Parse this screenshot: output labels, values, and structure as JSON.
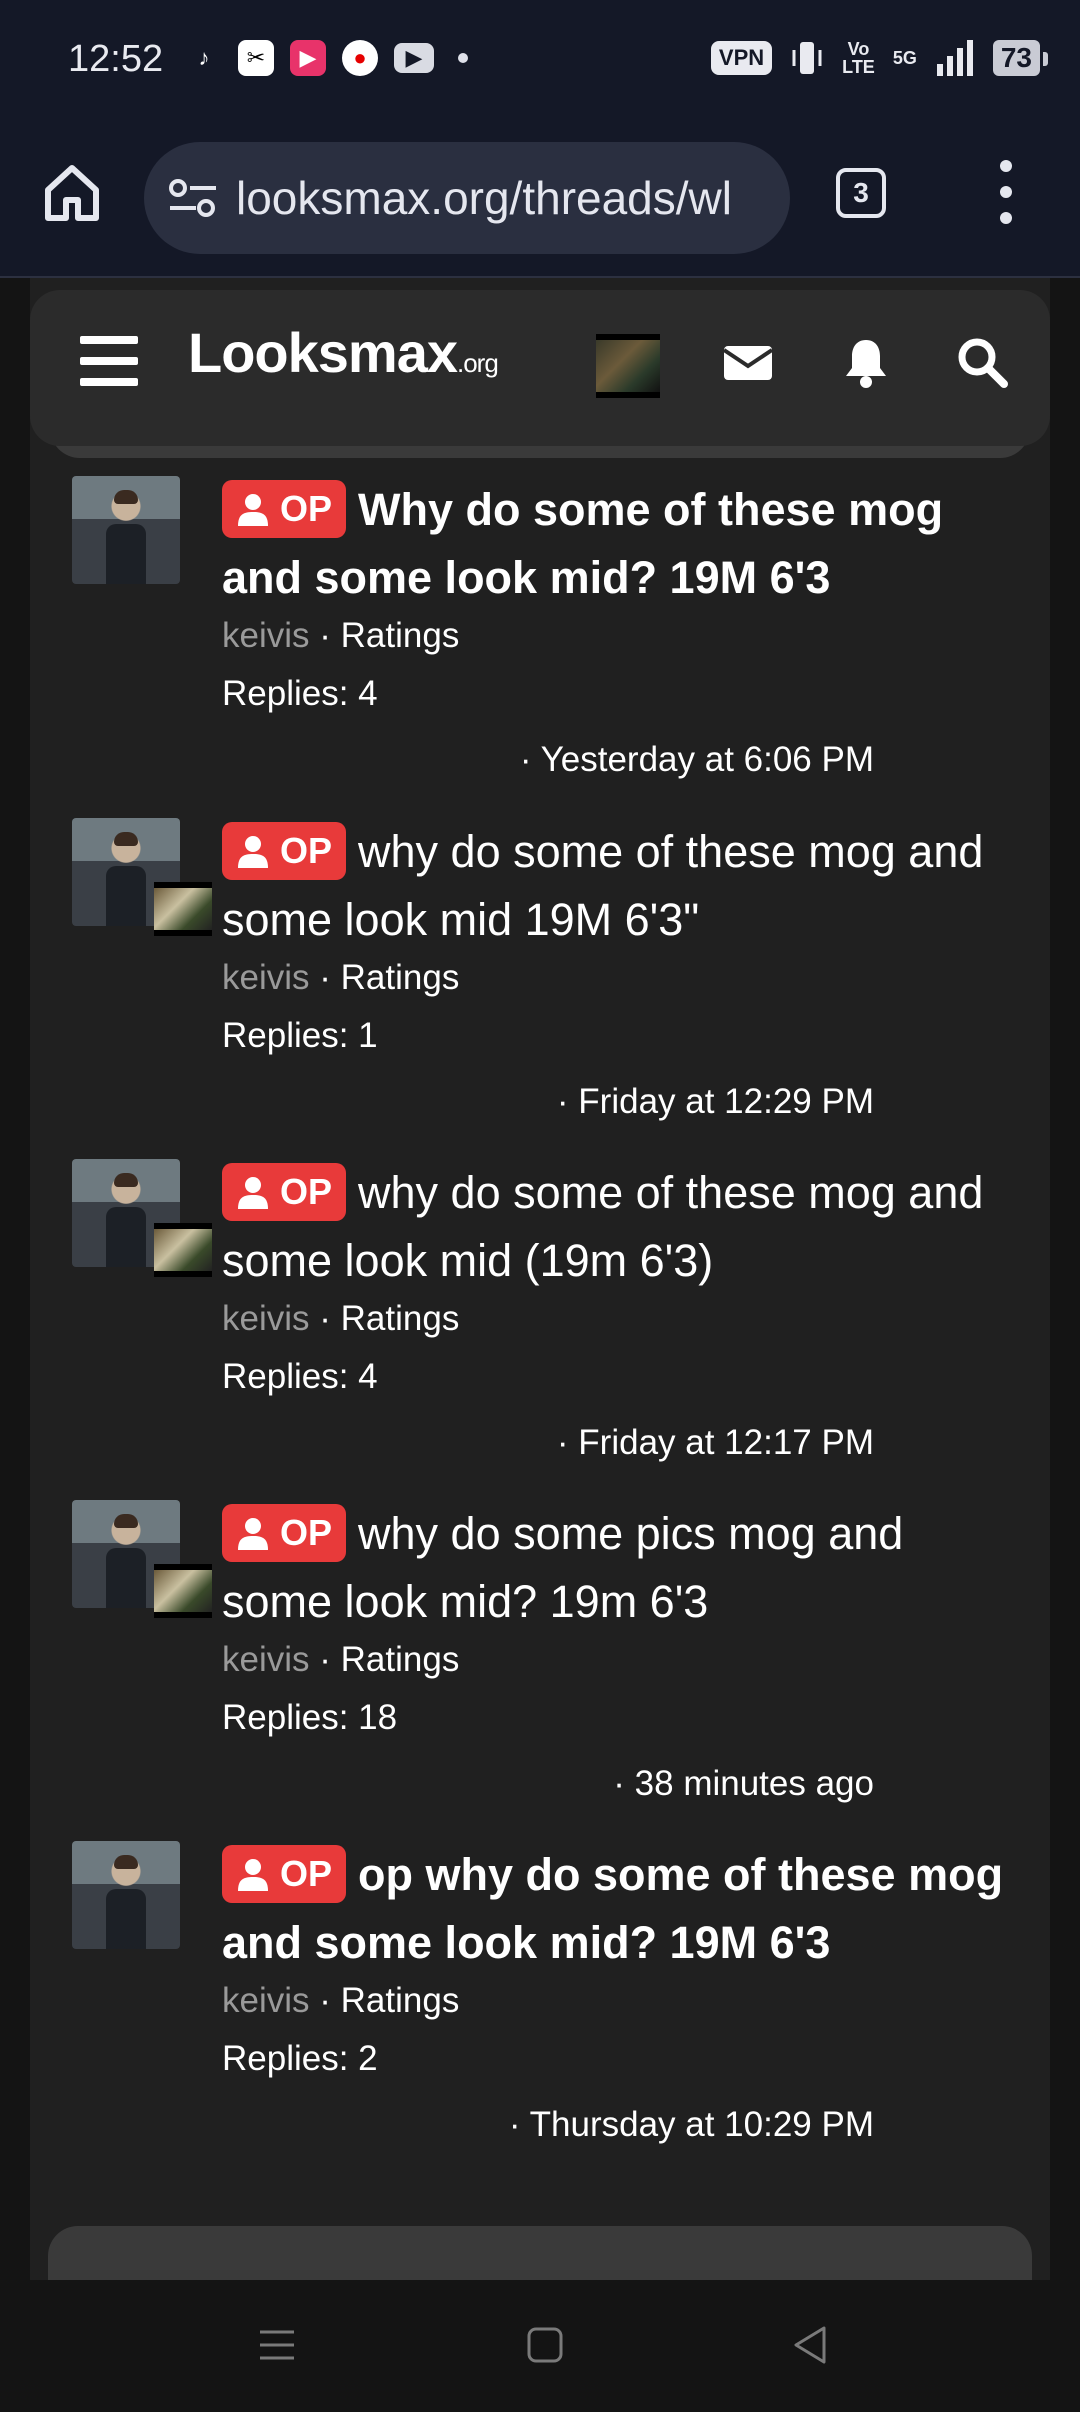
{
  "status_bar": {
    "time": "12:52",
    "apps": [
      "tiktok-icon",
      "capcut-icon",
      "video-app-icon",
      "vodafone-icon",
      "youtube-icon"
    ],
    "vpn": "VPN",
    "volte_line1": "Vo",
    "volte_line2": "LTE",
    "network": "5G",
    "battery": "73"
  },
  "browser": {
    "url": "looksmax.org/threads/wl",
    "tab_count": "3"
  },
  "site": {
    "logo_main": "Looksmax",
    "logo_suffix": ".org"
  },
  "threads": [
    {
      "badge": "OP",
      "title": "Why do some of these mog and some look mid? 19M 6'3",
      "unread": true,
      "author": "keivis",
      "forum": "Ratings",
      "replies": "Replies: 4",
      "date": "· Yesterday at 6:06 PM",
      "has_mini_avatar": false
    },
    {
      "badge": "OP",
      "title": "why do some of these mog and some look mid 19M 6'3\"",
      "unread": false,
      "author": "keivis",
      "forum": "Ratings",
      "replies": "Replies: 1",
      "date": "· Friday at 12:29 PM",
      "has_mini_avatar": true
    },
    {
      "badge": "OP",
      "title": "why do some of these mog and some look mid (19m 6'3)",
      "unread": false,
      "author": "keivis",
      "forum": "Ratings",
      "replies": "Replies: 4",
      "date": "· Friday at 12:17 PM",
      "has_mini_avatar": true
    },
    {
      "badge": "OP",
      "title": "why do some pics mog and some look mid? 19m 6'3",
      "unread": false,
      "author": "keivis",
      "forum": "Ratings",
      "replies": "Replies: 18",
      "date": "· 38 minutes ago",
      "has_mini_avatar": true
    },
    {
      "badge": "OP",
      "title": "op why do some of these mog and some look mid? 19M 6'3",
      "unread": true,
      "author": "keivis",
      "forum": "Ratings",
      "replies": "Replies: 2",
      "date": "· Thursday at 10:29 PM",
      "has_mini_avatar": false
    }
  ],
  "colors": {
    "op_badge": "#e83a3a",
    "page_bg": "#202020",
    "author_grey": "#9a9a9a"
  }
}
